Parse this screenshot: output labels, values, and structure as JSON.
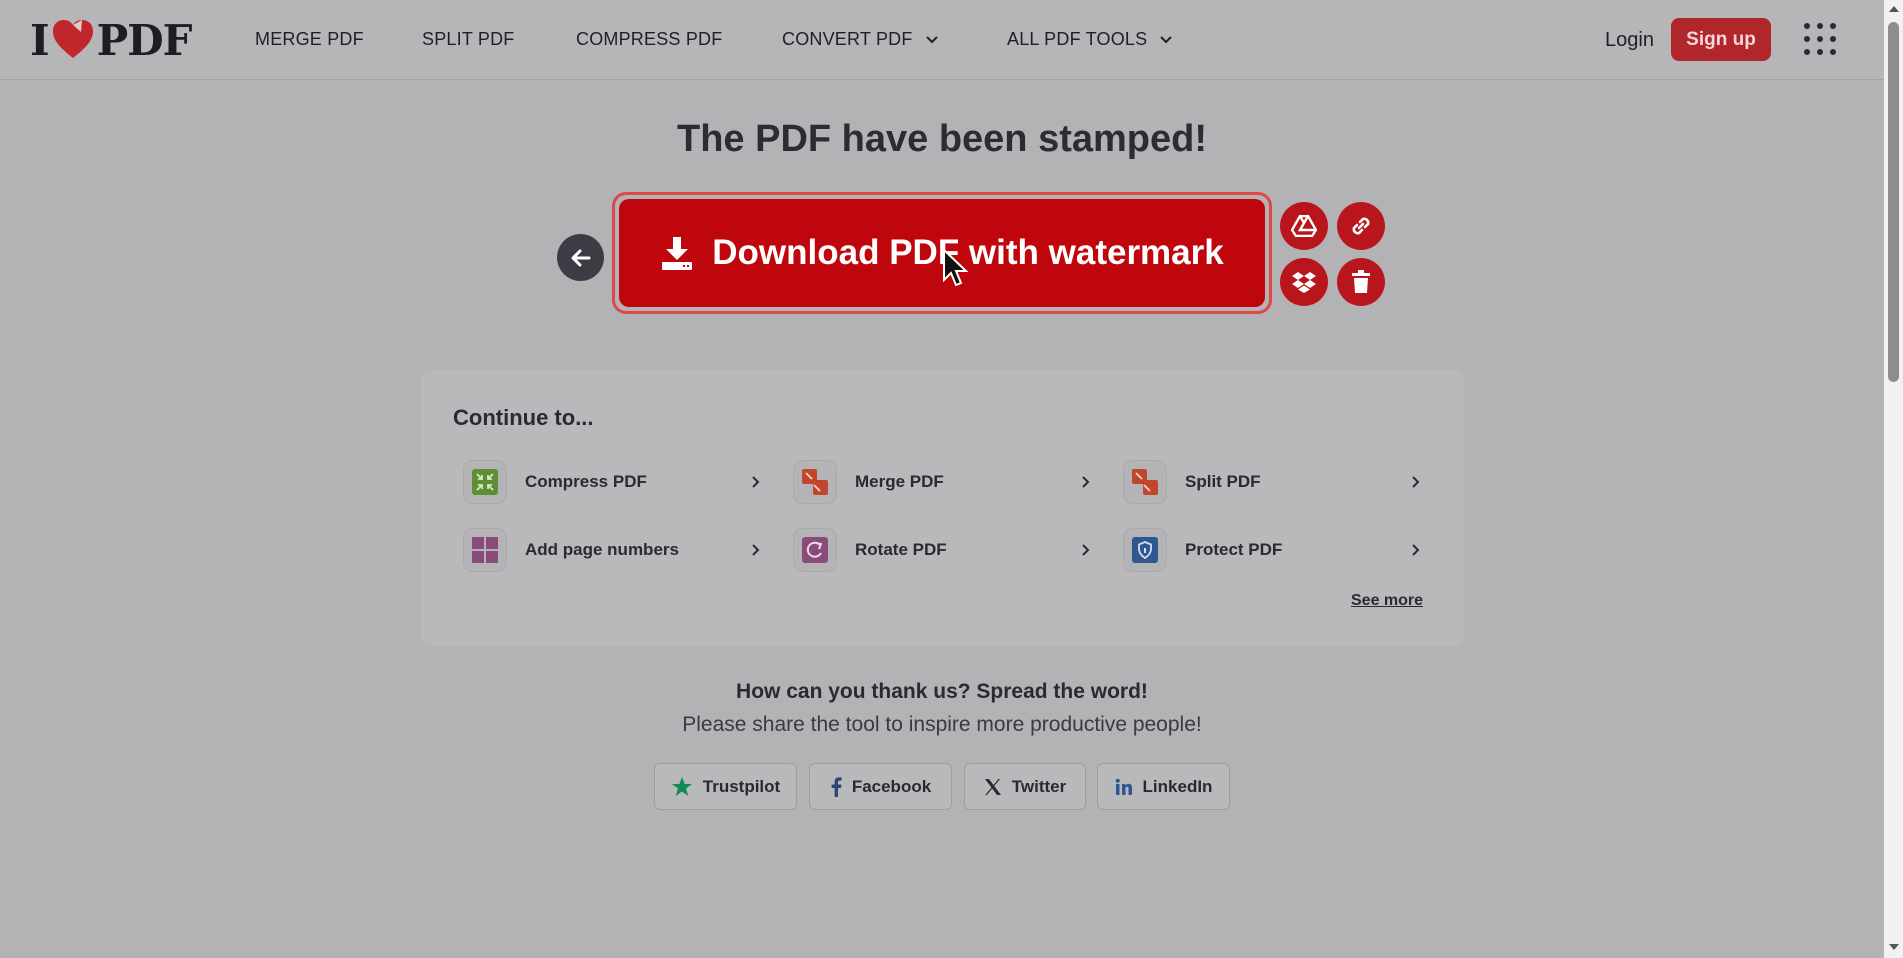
{
  "header": {
    "logo_left": "I",
    "logo_right": "PDF",
    "nav": [
      "MERGE PDF",
      "SPLIT PDF",
      "COMPRESS PDF",
      "CONVERT PDF",
      "ALL PDF TOOLS"
    ],
    "login": "Login",
    "signup": "Sign up"
  },
  "main": {
    "title": "The PDF have been stamped!",
    "download_label": "Download PDF with watermark"
  },
  "continue": {
    "title": "Continue to...",
    "tools": [
      {
        "label": "Compress PDF",
        "icon": "compress-icon"
      },
      {
        "label": "Merge PDF",
        "icon": "merge-icon"
      },
      {
        "label": "Split PDF",
        "icon": "split-icon"
      },
      {
        "label": "Add page numbers",
        "icon": "page-numbers-icon"
      },
      {
        "label": "Rotate PDF",
        "icon": "rotate-icon"
      },
      {
        "label": "Protect PDF",
        "icon": "protect-icon"
      }
    ],
    "see_more": "See more"
  },
  "share": {
    "thank": "How can you thank us? Spread the word!",
    "subtitle": "Please share the tool to inspire more productive people!",
    "buttons": [
      "Trustpilot",
      "Facebook",
      "Twitter",
      "LinkedIn"
    ]
  },
  "colors": {
    "brand_red": "#c0060d",
    "circle_red": "#b9151c",
    "overlay_grey": "#b3b3b5"
  }
}
